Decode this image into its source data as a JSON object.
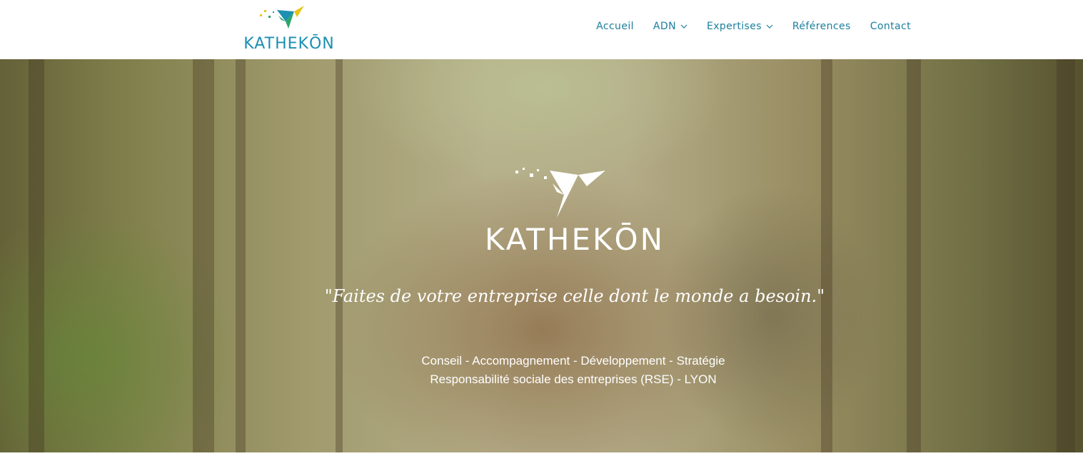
{
  "header": {
    "logo_text": "KATHEKŌN",
    "nav": [
      {
        "label": "Accueil",
        "has_dropdown": false
      },
      {
        "label": "ADN",
        "has_dropdown": true
      },
      {
        "label": "Expertises",
        "has_dropdown": true
      },
      {
        "label": "Références",
        "has_dropdown": false
      },
      {
        "label": "Contact",
        "has_dropdown": false
      }
    ]
  },
  "hero": {
    "logo_text": "KATHEKŌN",
    "quote": "\"Faites de votre entreprise celle dont le monde a besoin.\"",
    "services": "Conseil - Accompagnement - Développement - Stratégie",
    "rse": "Responsabilité sociale des entreprises (RSE) - LYON"
  },
  "colors": {
    "brand_teal": "#1c8fb2",
    "nav_text": "#1b7f9c",
    "logo_yellow": "#e6c619",
    "logo_green": "#2aa56a",
    "hero_text": "#ffffff"
  }
}
